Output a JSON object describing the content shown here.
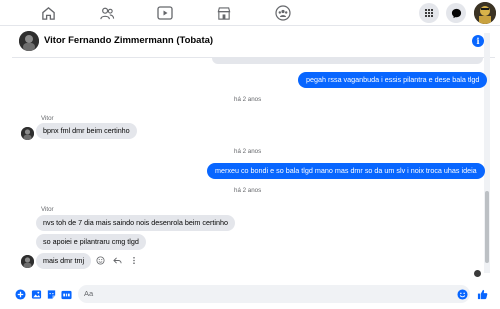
{
  "topnav": {
    "icons": [
      "home-icon",
      "friends-icon",
      "watch-icon",
      "marketplace-icon",
      "groups-icon"
    ],
    "right": [
      "menu-grid-icon",
      "messenger-icon"
    ]
  },
  "chat": {
    "contact_name": "Vitor Fernando Zimmermann (Tobata)",
    "info_glyph": "i",
    "messages": {
      "out1": "pegah rssa vaganbuda i essis pilantra e dese bala tlgd",
      "ts1": "há 2 anos",
      "sender1": "Vitor",
      "in1": "bpnx fml dmr beim certinho",
      "ts2": "há 2 anos",
      "out2": "merxeu co bondi e so bala tlgd mano mas dmr so da um slv i noix troca uhas ideia",
      "ts3": "há 2 anos",
      "sender2": "Vitor",
      "in2": "nvs toh de 7 dia mais saindo nois desenrola beim certinho",
      "in3": "so apoiei e pilantraru cmg tlgd",
      "in4": "mais dmr tmj"
    }
  },
  "composer": {
    "placeholder": "Aa"
  },
  "colors": {
    "accent": "#0866ff",
    "incoming_bubble": "#e4e6eb",
    "secondary_text": "#65676b"
  }
}
